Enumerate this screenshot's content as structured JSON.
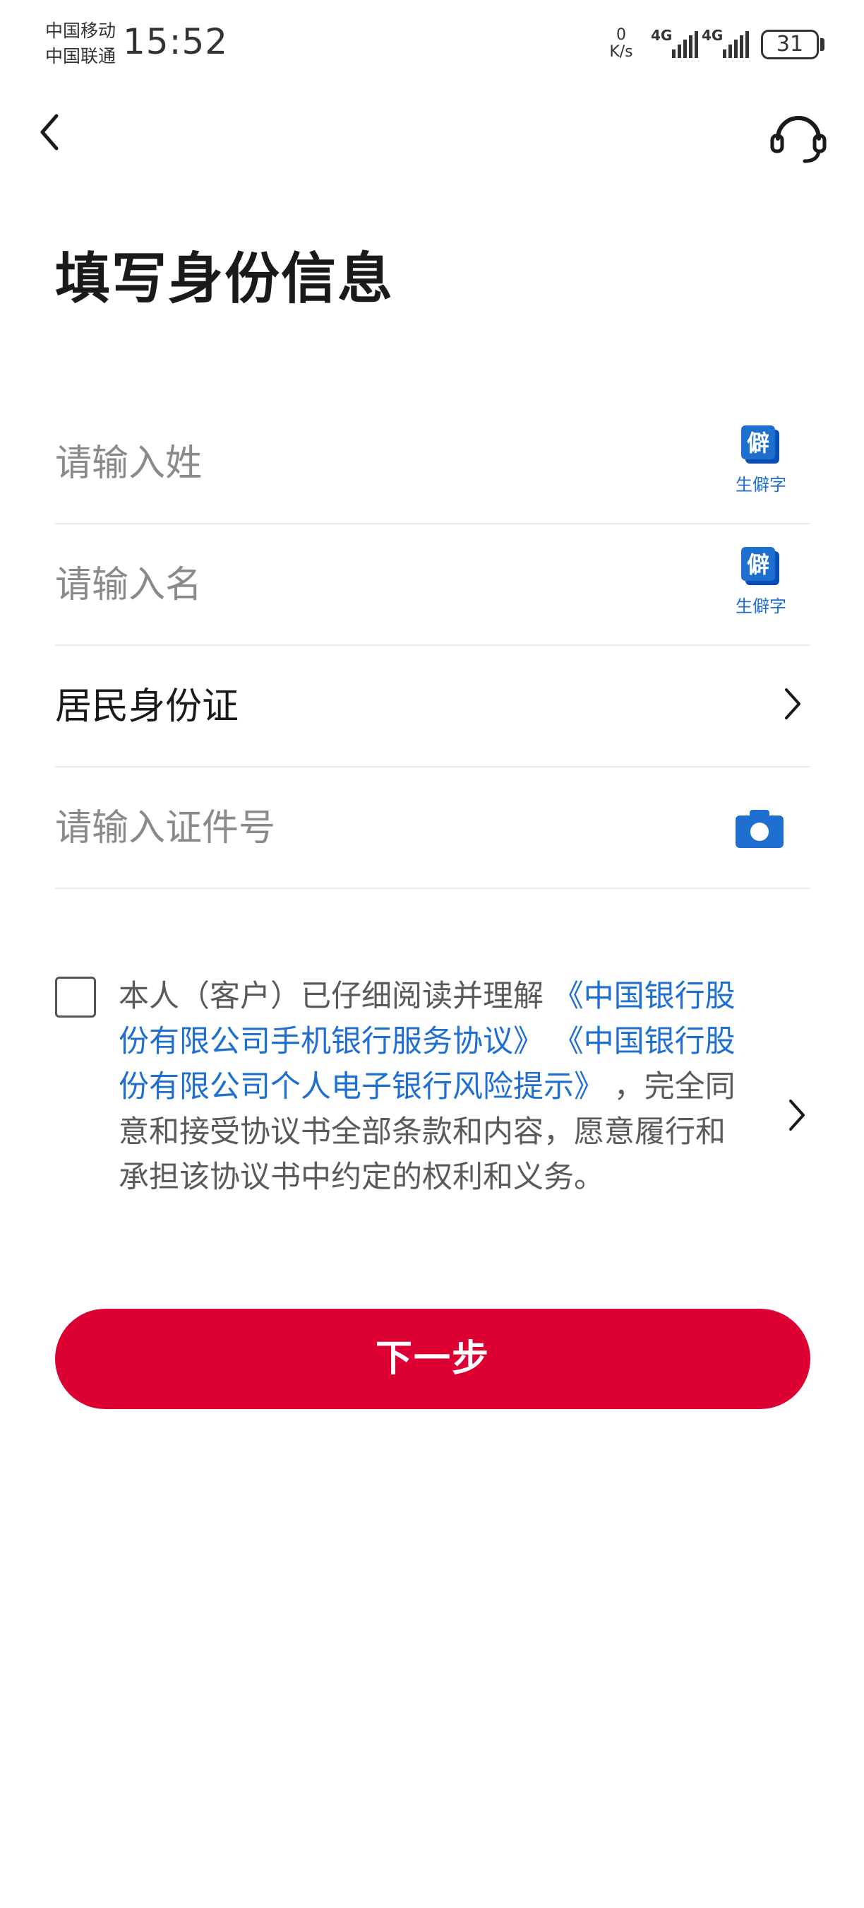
{
  "status_bar": {
    "carrier_1": "中国移动",
    "carrier_2": "中国联通",
    "time": "15:52",
    "net_speed_value": "0",
    "net_speed_unit": "K/s",
    "signal_1_label": "4G",
    "signal_2_label": "4G",
    "battery_level": "31"
  },
  "header": {
    "back_icon": "chevron-left-icon",
    "customer_service_icon": "headset-icon"
  },
  "page": {
    "title": "填写身份信息"
  },
  "form": {
    "surname_placeholder": "请输入姓",
    "given_name_placeholder": "请输入名",
    "rare_char_badge": "僻",
    "rare_char_label": "生僻字",
    "id_type_value": "居民身份证",
    "id_number_placeholder": "请输入证件号",
    "camera_icon": "camera-icon"
  },
  "agreement": {
    "text_prefix": "本人（客户）已仔细阅读并理解",
    "link_1": "《中国银行股份有限公司手机银行服务协议》",
    "link_2": "《中国银行股份有限公司个人电子银行风险提示》",
    "text_suffix": "，完全同意和接受协议书全部条款和内容，愿意履行和承担该协议书中约定的权利和义务。",
    "checked": false
  },
  "actions": {
    "next_label": "下一步"
  },
  "colors": {
    "brand_red": "#dd0033",
    "link_blue": "#1f6fd1"
  }
}
